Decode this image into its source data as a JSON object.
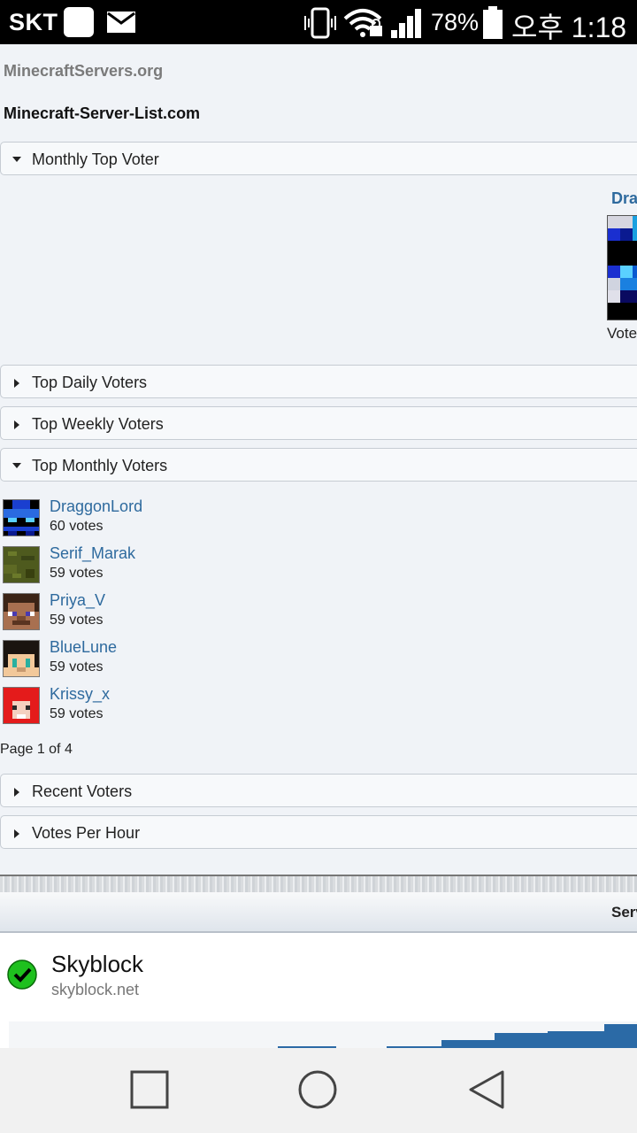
{
  "status_bar": {
    "carrier": "SKT",
    "battery_percent": "78%",
    "time": "오후 1:18",
    "icons": [
      "square-app-icon",
      "mail-icon",
      "vibrate-icon",
      "wifi-lock-icon",
      "signal-icon",
      "battery-icon"
    ]
  },
  "links": {
    "site1": "MinecraftServers.org",
    "site2": "Minecraft-Server-List.com"
  },
  "sections": {
    "monthly_top_voter": "Monthly Top Voter",
    "top_daily": "Top Daily Voters",
    "top_weekly": "Top Weekly Voters",
    "top_monthly": "Top Monthly Voters",
    "recent": "Recent Voters",
    "per_hour": "Votes Per Hour"
  },
  "top_voter": {
    "name_visible": "Dra",
    "votes_visible": "Vote"
  },
  "voters": [
    {
      "name": "DraggonLord",
      "votes": "60 votes",
      "avatar_color": "#1a3fd0"
    },
    {
      "name": "Serif_Marak",
      "votes": "59 votes",
      "avatar_color": "#4e5a1e"
    },
    {
      "name": "Priya_V",
      "votes": "59 votes",
      "avatar_color": "#8a5a3a"
    },
    {
      "name": "BlueLune",
      "votes": "59 votes",
      "avatar_color": "#f2c89a"
    },
    {
      "name": "Krissy_x",
      "votes": "59 votes",
      "avatar_color": "#e41b1b"
    }
  ],
  "pagination": "Page 1 of 4",
  "server_table": {
    "header_visible": "Serv"
  },
  "server": {
    "name": "Skyblock",
    "host": "skyblock.net",
    "status": "online"
  },
  "colors": {
    "link": "#2e6a9e",
    "online": "#1ec01e",
    "graph": "#2b6aa6"
  }
}
